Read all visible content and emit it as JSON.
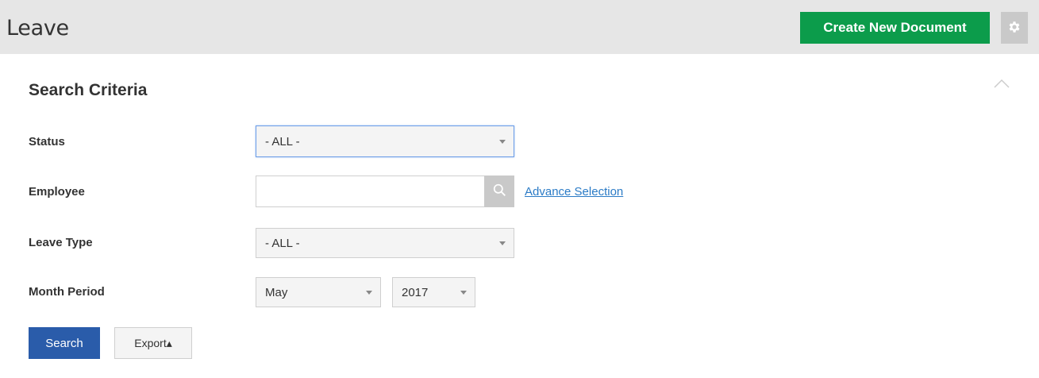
{
  "header": {
    "title": "Leave",
    "create_label": "Create New Document",
    "settings_icon": "gear-icon"
  },
  "search_panel": {
    "title": "Search Criteria",
    "collapse_icon": "chevron-up-icon",
    "fields": {
      "status": {
        "label": "Status",
        "selected": "- ALL -"
      },
      "employee": {
        "label": "Employee",
        "value": "",
        "search_icon": "search-icon",
        "advance_label": "Advance Selection"
      },
      "leave_type": {
        "label": "Leave Type",
        "selected": "- ALL -"
      },
      "month_period": {
        "label": "Month Period",
        "month": "May",
        "year": "2017"
      }
    },
    "buttons": {
      "search_label": "Search",
      "export_label": "Export▴"
    }
  }
}
